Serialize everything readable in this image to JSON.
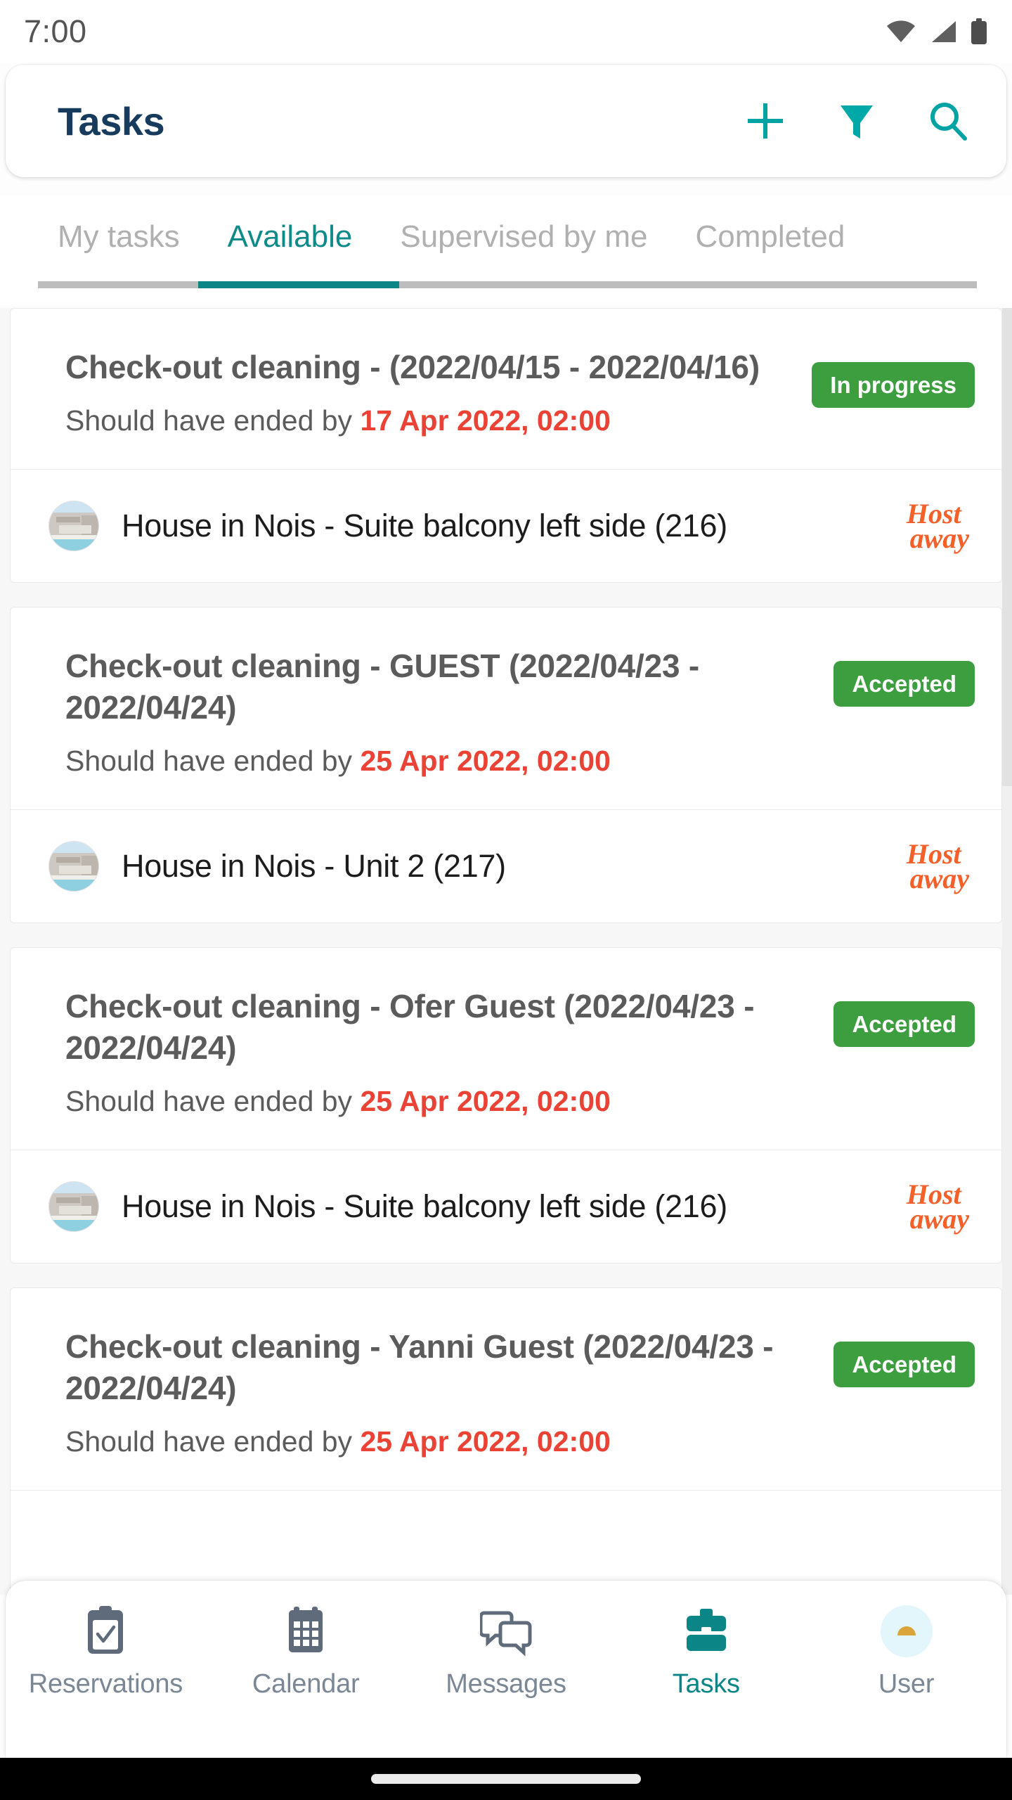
{
  "status_bar": {
    "time": "7:00",
    "icons": [
      "wifi-icon",
      "cellular-signal-icon",
      "battery-icon"
    ]
  },
  "app_bar": {
    "title": "Tasks",
    "actions": [
      {
        "name": "add-task-button",
        "icon": "plus-icon"
      },
      {
        "name": "filter-button",
        "icon": "funnel-icon"
      },
      {
        "name": "search-button",
        "icon": "search-icon"
      }
    ],
    "accent_color": "#00a3a3",
    "title_color": "#163b5c"
  },
  "tabs": {
    "items": [
      {
        "label": "My tasks",
        "active": false
      },
      {
        "label": "Available",
        "active": true
      },
      {
        "label": "Supervised by me",
        "active": false
      },
      {
        "label": "Completed",
        "active": false
      }
    ],
    "active_color": "#0f8a8a",
    "inactive_color": "#b0b0b0"
  },
  "colors": {
    "badge_green": "#3d9e40",
    "due_red": "#ea4335",
    "hostaway_orange": "#f4602a",
    "teal": "#0b8585"
  },
  "tasks": [
    {
      "title": "Check-out cleaning - (2022/04/15 - 2022/04/16)",
      "due_prefix": "Should have ended by",
      "due_date": "17 Apr 2022, 02:00",
      "status": "In progress",
      "property": "House in Nois - Suite balcony left side (216)",
      "channel_logo_line1": "Host",
      "channel_logo_line2": "away"
    },
    {
      "title": "Check-out cleaning - GUEST (2022/04/23 - 2022/04/24)",
      "due_prefix": "Should have ended by",
      "due_date": "25 Apr 2022, 02:00",
      "status": "Accepted",
      "property": "House in Nois - Unit 2 (217)",
      "channel_logo_line1": "Host",
      "channel_logo_line2": "away"
    },
    {
      "title": "Check-out cleaning - Ofer Guest (2022/04/23 - 2022/04/24)",
      "due_prefix": "Should have ended by",
      "due_date": "25 Apr 2022, 02:00",
      "status": "Accepted",
      "property": "House in Nois - Suite balcony left side (216)",
      "channel_logo_line1": "Host",
      "channel_logo_line2": "away"
    },
    {
      "title": "Check-out cleaning - Yanni Guest (2022/04/23 - 2022/04/24)",
      "due_prefix": "Should have ended by",
      "due_date": "25 Apr 2022, 02:00",
      "status": "Accepted",
      "property": "",
      "channel_logo_line1": "",
      "channel_logo_line2": ""
    }
  ],
  "bottom_nav": {
    "items": [
      {
        "label": "Reservations",
        "icon": "clipboard-check-icon",
        "active": false
      },
      {
        "label": "Calendar",
        "icon": "calendar-grid-icon",
        "active": false
      },
      {
        "label": "Messages",
        "icon": "chat-bubbles-icon",
        "active": false
      },
      {
        "label": "Tasks",
        "icon": "briefcase-icon",
        "active": true
      },
      {
        "label": "User",
        "icon": "avatar-icon",
        "active": false
      }
    ]
  }
}
